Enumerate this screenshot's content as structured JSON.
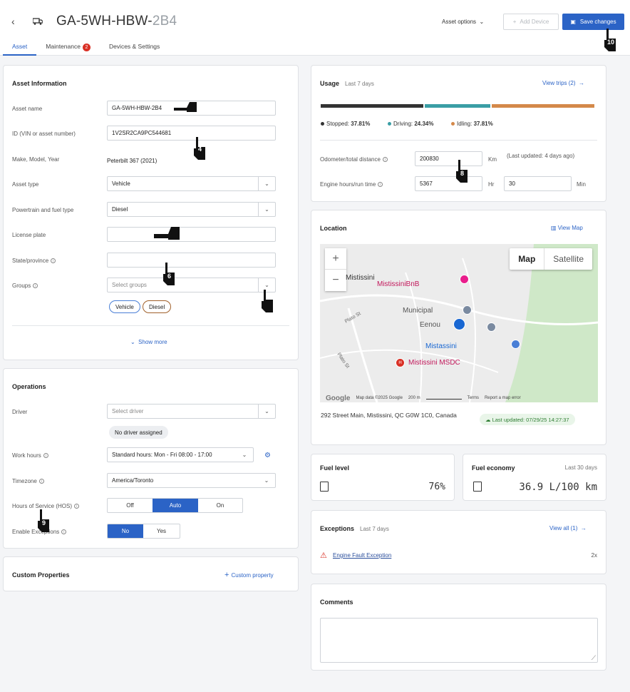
{
  "header": {
    "title_main": "GA-5WH-HBW-",
    "title_faded": "2B4",
    "asset_options": "Asset options",
    "add_device": "Add Device",
    "save_button": "Save changes"
  },
  "tabs": [
    {
      "label": "Asset"
    },
    {
      "label": "Maintenance",
      "badge": "2"
    },
    {
      "label": "Devices & Settings"
    }
  ],
  "asset_info": {
    "title": "Asset Information",
    "asset_name_label": "Asset name",
    "asset_name": "GA-5WH-HBW-2B4",
    "id_label": "ID (VIN or asset number)",
    "id_value": "1V2SR2CA9PC544681",
    "make_label": "Make, Model, Year",
    "make_value": "Peterbilt 367 (2021)",
    "asset_type_label": "Asset type",
    "asset_type": "Vehicle",
    "powertrain_label": "Powertrain and fuel type",
    "powertrain": "Diesel",
    "license_label": "License plate",
    "state_label": "State/province",
    "groups_label": "Groups",
    "groups_placeholder": "Select groups",
    "chips": [
      "Vehicle",
      "Diesel"
    ],
    "show_more": "Show more"
  },
  "operations": {
    "title": "Operations",
    "driver_label": "Driver",
    "driver_placeholder": "Select driver",
    "no_driver": "No driver assigned",
    "work_hours_label": "Work hours",
    "work_hours": "Standard hours: Mon - Fri 08:00 - 17:00",
    "timezone_label": "Timezone",
    "timezone": "America/Toronto",
    "hos_label": "Hours of Service (HOS)",
    "hos_options": [
      "Off",
      "Auto",
      "On"
    ],
    "enable_label": "Enable Exceptions",
    "enable_options": [
      "No",
      "Yes"
    ]
  },
  "custom": {
    "title": "Custom Properties",
    "add": "Custom property"
  },
  "usage": {
    "title": "Usage",
    "period": "Last 7 days",
    "view_trips": "View trips (2)",
    "stopped": "Stopped: ",
    "stopped_pct": "37.81%",
    "driving": "Driving: ",
    "driving_pct": "24.34%",
    "idling": "Idling: ",
    "idling_pct": "37.81%",
    "segments": [
      37.81,
      24.34,
      37.81
    ],
    "colors": {
      "stopped": "#333333",
      "driving": "#3a9ea5",
      "idling": "#d4894a"
    },
    "odometer_label": "Odometer/total distance",
    "odometer": "200830",
    "odometer_unit": "Km",
    "last_updated": "(Last updated: 4 days ago)",
    "engine_label": "Engine hours/run time",
    "engine_hours": "5367",
    "engine_hours_unit": "Hr",
    "engine_min": "30",
    "engine_min_unit": "Min"
  },
  "location": {
    "title": "Location",
    "view_map": "View Map",
    "map_btn": "Map",
    "satellite_btn": "Satellite",
    "labels": [
      "Mistissini",
      "MistissiniBnB",
      "Municipal",
      "Eenou",
      "Mistassini",
      "Mistissini MSDC",
      "Plato St",
      "Plato St"
    ],
    "address": "292 Street Main, Mistissini, QC G0W 1C0, Canada",
    "last_updated": "Last updated: 07/29/25 14:27:37",
    "map_footer": [
      "Google",
      "Map data ©2025 Google",
      "200 m",
      "Terms",
      "Report a map error"
    ]
  },
  "fuel": {
    "title": "Fuel level",
    "value": "76%"
  },
  "economy": {
    "title": "Fuel economy",
    "period": "Last 30 days",
    "value": "36.9 L/100 km"
  },
  "exceptions": {
    "title": "Exceptions",
    "period": "Last 7 days",
    "view_all": "View all (1)",
    "item": "Engine Fault Exception",
    "count": "2x"
  },
  "comments": {
    "title": "Comments"
  },
  "cursor_labels": [
    "4",
    "6",
    "8",
    "9",
    "10"
  ]
}
